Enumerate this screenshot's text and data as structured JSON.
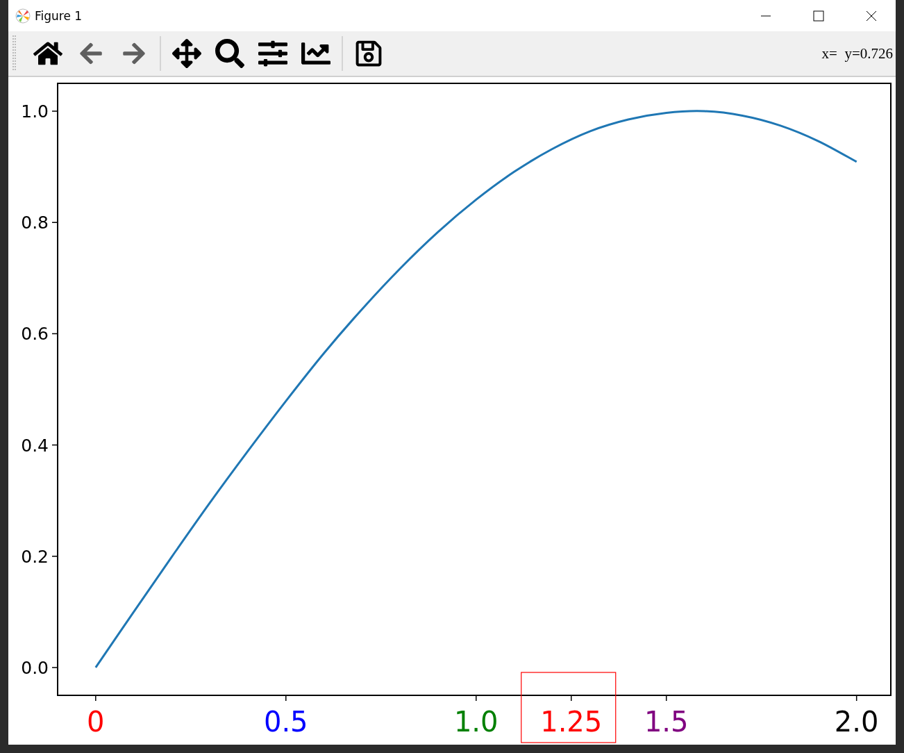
{
  "window": {
    "title": "Figure 1"
  },
  "toolbar": {
    "tools": [
      {
        "kind": "home",
        "disabled": false
      },
      {
        "kind": "back",
        "disabled": true
      },
      {
        "kind": "forward",
        "disabled": true
      },
      {
        "kind": "separator"
      },
      {
        "kind": "pan",
        "disabled": false
      },
      {
        "kind": "zoom",
        "disabled": false
      },
      {
        "kind": "subplots",
        "disabled": false
      },
      {
        "kind": "customize",
        "disabled": false
      },
      {
        "kind": "separator"
      },
      {
        "kind": "save",
        "disabled": false
      }
    ],
    "coordinates": "x=  y=0.726"
  },
  "figure": {
    "chart_data": {
      "type": "line",
      "x": [
        0,
        0.1,
        0.2,
        0.3,
        0.4,
        0.5,
        0.6,
        0.7,
        0.8,
        0.9,
        1.0,
        1.1,
        1.2,
        1.3,
        1.4,
        1.5,
        1.6,
        1.7,
        1.8,
        1.9,
        2.0
      ],
      "series": [
        {
          "color": "#1f77b4",
          "values": [
            0,
            0.1,
            0.199,
            0.296,
            0.389,
            0.479,
            0.565,
            0.644,
            0.717,
            0.783,
            0.841,
            0.891,
            0.932,
            0.964,
            0.985,
            0.997,
            1.0,
            0.992,
            0.974,
            0.946,
            0.909
          ]
        }
      ],
      "xlim": [
        -0.1,
        2.09
      ],
      "ylim": [
        -0.05,
        1.05
      ],
      "xticks": [
        {
          "value": 0,
          "label": "0"
        },
        {
          "value": 0.5,
          "label": "0.5"
        },
        {
          "value": 1.0,
          "label": "1.0"
        },
        {
          "value": 1.25,
          "label": "1.25"
        },
        {
          "value": 1.5,
          "label": "1.5"
        },
        {
          "value": 2.0,
          "label": "2.0"
        }
      ],
      "yticks": [
        {
          "value": 0,
          "label": "0.0"
        },
        {
          "value": 0.2,
          "label": "0.2"
        },
        {
          "value": 0.4,
          "label": "0.4"
        },
        {
          "value": 0.6,
          "label": "0.6"
        },
        {
          "value": 0.8,
          "label": "0.8"
        },
        {
          "value": 1.0,
          "label": "1.0"
        }
      ]
    },
    "xtick_styles": [
      {
        "color": "#ff0000",
        "boxed": false
      },
      {
        "color": "#0000ff",
        "boxed": false
      },
      {
        "color": "#008000",
        "boxed": false
      },
      {
        "color": "#ff0000",
        "boxed": true
      },
      {
        "color": "#800080",
        "boxed": false
      },
      {
        "color": "#000000",
        "boxed": false
      }
    ]
  }
}
